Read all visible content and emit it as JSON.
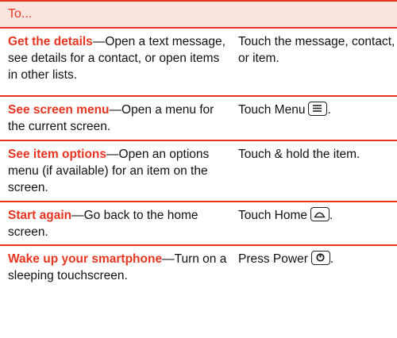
{
  "header": {
    "label": "To..."
  },
  "rows": [
    {
      "title": "Get the details",
      "desc": "—Open a text message, see details for a contact, or open items in other lists.",
      "action": "Touch the message, contact, or item.",
      "icon": ""
    },
    {
      "title": "See screen menu",
      "desc": "—Open a menu for the current screen.",
      "action": "Touch Menu",
      "icon": "menu-key-icon"
    },
    {
      "title": "See item options",
      "desc": "—Open an options menu (if available) for an item on the screen.",
      "action": "Touch & hold the item.",
      "icon": ""
    },
    {
      "title": "Start again",
      "desc": "—Go back to the home screen.",
      "action": "Touch Home",
      "icon": "home-key-icon"
    },
    {
      "title": "Wake up your smartphone",
      "desc": "—Turn on a sleeping touchscreen.",
      "action": "Press Power",
      "icon": "power-key-icon"
    }
  ],
  "colors": {
    "accent": "#e8351f",
    "header_bg": "#fbe3de"
  }
}
